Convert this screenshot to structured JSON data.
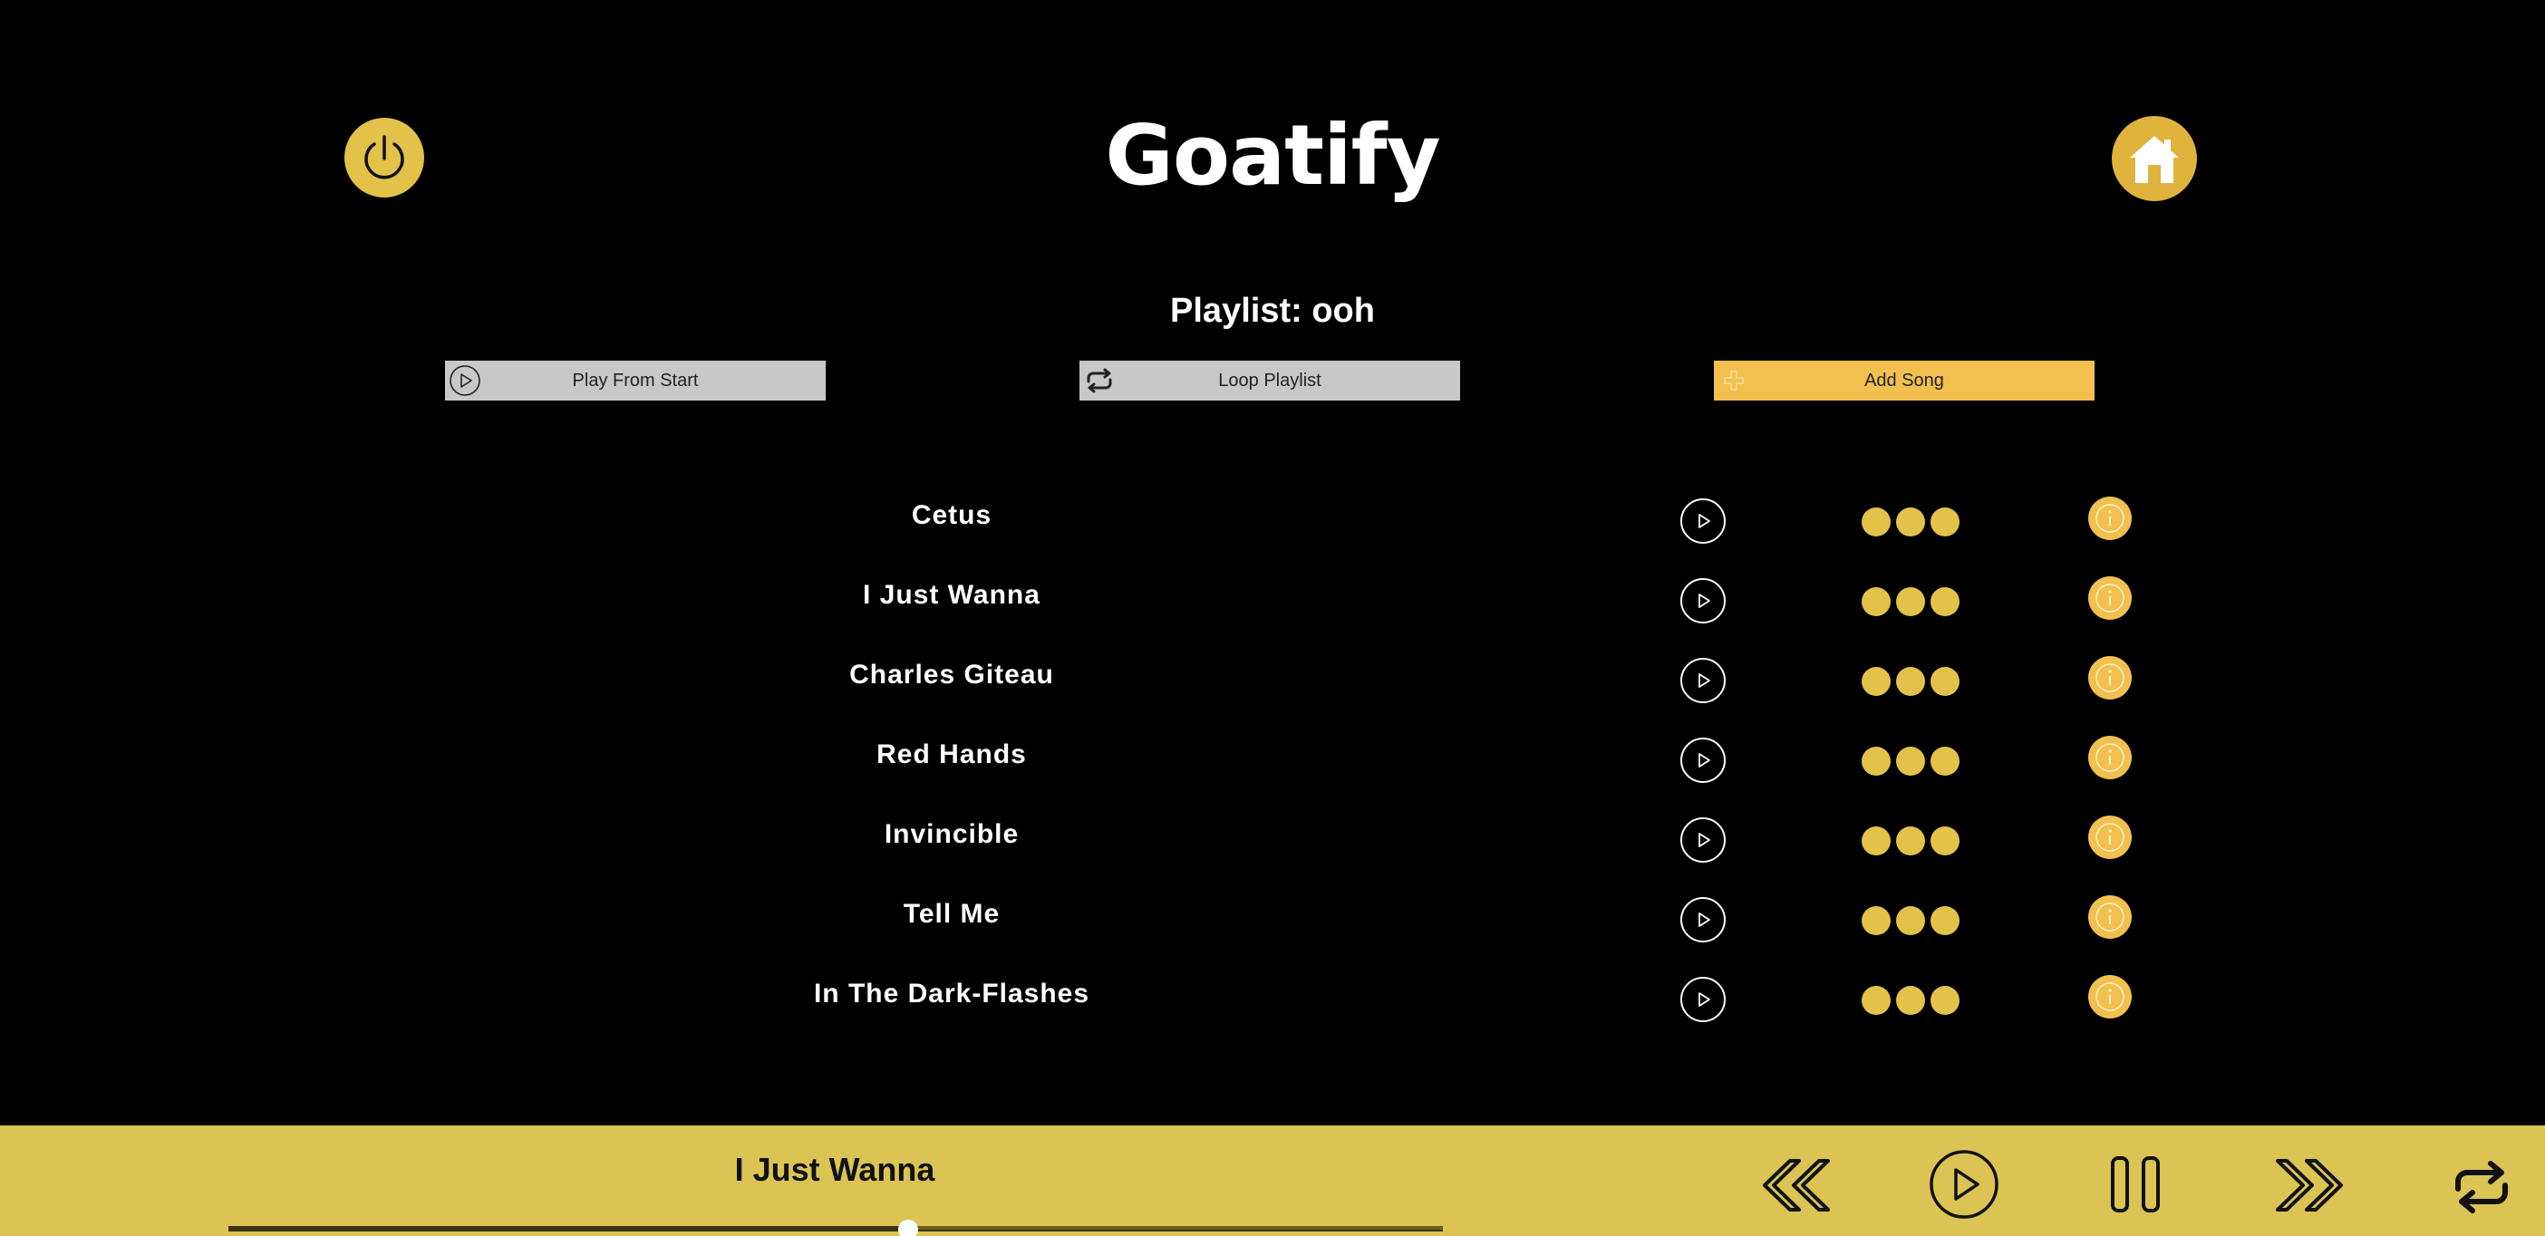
{
  "app": {
    "title": "Goatify"
  },
  "header": {
    "power_icon": "power-icon",
    "home_icon": "home-icon"
  },
  "playlist": {
    "heading": "Playlist: ooh"
  },
  "actions": {
    "play_from_start": "Play From Start",
    "loop_playlist": "Loop Playlist",
    "add_song": "Add Song"
  },
  "songs": [
    {
      "title": "Cetus"
    },
    {
      "title": "I Just Wanna"
    },
    {
      "title": "Charles Giteau"
    },
    {
      "title": "Red Hands"
    },
    {
      "title": "Invincible"
    },
    {
      "title": "Tell Me"
    },
    {
      "title": "In The Dark-Flashes"
    }
  ],
  "player": {
    "now_playing": "I Just Wanna",
    "progress": 0.56
  },
  "colors": {
    "background": "#000000",
    "accent": "#e3c24a",
    "player_bar": "#dbc454",
    "button_gray": "#c8c8c8",
    "add_button": "#f1c04f"
  }
}
